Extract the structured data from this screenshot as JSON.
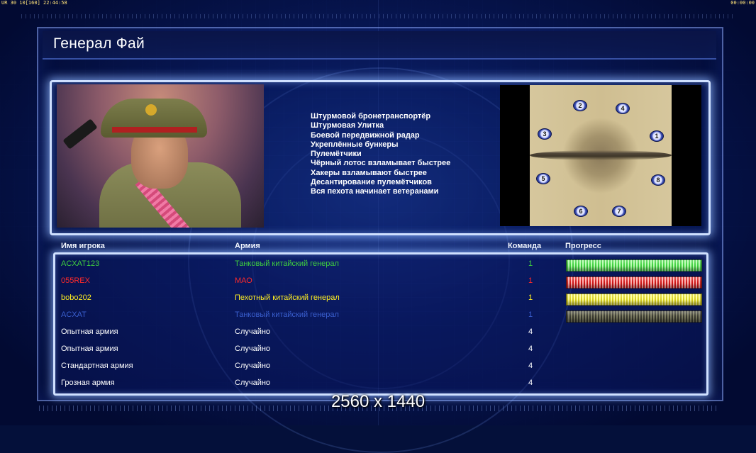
{
  "hud": {
    "top_left": "UR 30 10[160] 22:44:58",
    "top_right": "00:00:00"
  },
  "title": "Генерал Фай",
  "bonuses": [
    "Штурмовой бронетранспортёр",
    "Штурмовая Улитка",
    "Боевой передвижной радар",
    "Укреплённые бункеры",
    "Пулемётчики",
    "Чёрный лотос взламывает быстрее",
    "Хакеры взламывают быстрее",
    "Десантирование пулемётчиков",
    "Вся пехота начинает ветеранами"
  ],
  "map": {
    "slots": [
      "2",
      "4",
      "3",
      "1",
      "5",
      "8",
      "6",
      "7"
    ]
  },
  "columns": {
    "name": "Имя игрока",
    "army": "Армия",
    "team": "Команда",
    "progress": "Прогресс"
  },
  "players": [
    {
      "name": "ACXAT123",
      "army": "Танковый китайский генерал",
      "team": "1",
      "color": "#3fcf3f",
      "progress": 1.0,
      "bar1": "#3fd03f",
      "bar2": "#b8ffb0"
    },
    {
      "name": "055REX",
      "army": "МАО",
      "team": "1",
      "color": "#ff2a2a",
      "progress": 1.0,
      "bar1": "#d01818",
      "bar2": "#ffb0b0"
    },
    {
      "name": "bobo202",
      "army": "Пехотный китайский генерал",
      "team": "1",
      "color": "#ffee22",
      "progress": 1.0,
      "bar1": "#d8d020",
      "bar2": "#ffff9a"
    },
    {
      "name": "ACXAT",
      "army": "Танковый китайский генерал",
      "team": "1",
      "color": "#3a5fcf",
      "progress": 1.0,
      "bar1": "#3a3a30",
      "bar2": "#7a7a60"
    },
    {
      "name": "Опытная армия",
      "army": "Случайно",
      "team": "4",
      "color": "#ffffff"
    },
    {
      "name": "Опытная армия",
      "army": "Случайно",
      "team": "4",
      "color": "#ffffff"
    },
    {
      "name": "Стандартная армия",
      "army": "Случайно",
      "team": "4",
      "color": "#ffffff"
    },
    {
      "name": "Грозная армия",
      "army": "Случайно",
      "team": "4",
      "color": "#ffffff"
    }
  ],
  "resolution": "2560 x 1440"
}
